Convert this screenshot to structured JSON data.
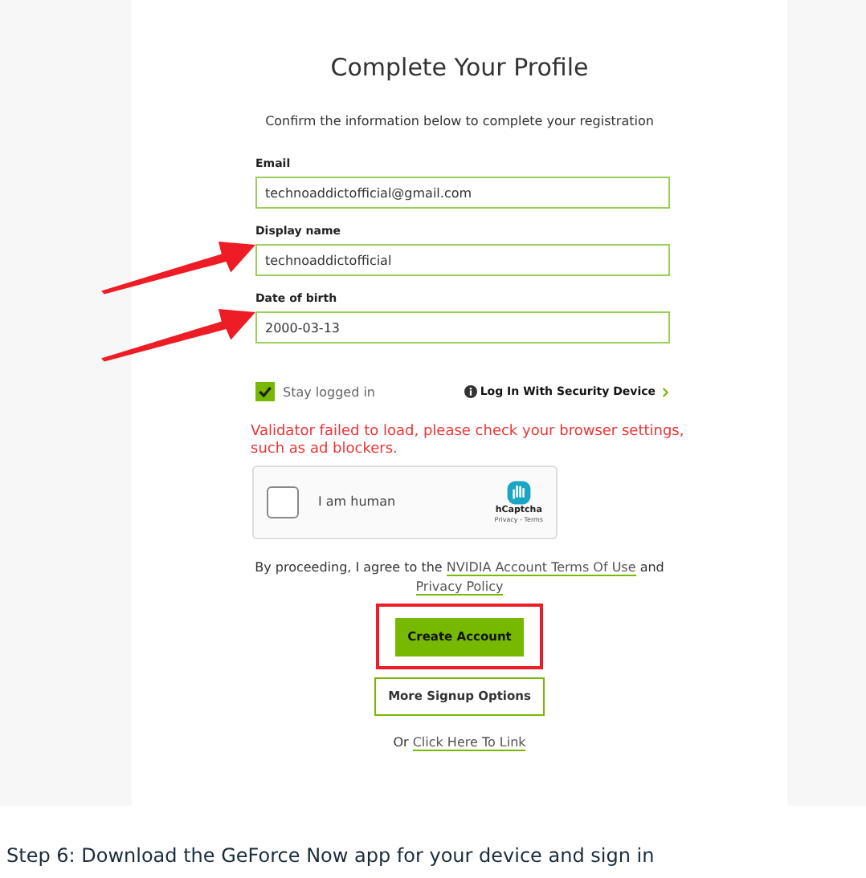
{
  "title": "Complete Your Profile",
  "subtitle": "Confirm the information below to complete your registration",
  "fields": [
    {
      "label": "Email",
      "value": "technoaddictofficial@gmail.com",
      "arrow": false
    },
    {
      "label": "Display name",
      "value": "technoaddictofficial",
      "arrow": true
    },
    {
      "label": "Date of birth",
      "value": "2000-03-13",
      "arrow": true
    }
  ],
  "stay_logged_in": {
    "label": "Stay logged in",
    "checked": true
  },
  "security_device_link": "Log In With Security Device",
  "error": "Validator failed to load, please check your browser settings, such as ad blockers.",
  "captcha": {
    "label": "I am human",
    "checked": false,
    "brand": "hCaptcha",
    "links": "Privacy - Terms"
  },
  "agreement": {
    "text": "By proceeding, I agree to the",
    "link1": "NVIDIA Account Terms Of Use",
    "and": "and",
    "link2": "Privacy Policy"
  },
  "create_account": {
    "label": "Create Account",
    "highlighted": true
  },
  "more_options": "More Signup Options",
  "link_line": {
    "prefix": "Or",
    "link": "Click Here To Link"
  },
  "footer_text": "Step 6: Download the GeForce Now app for your device and sign in"
}
